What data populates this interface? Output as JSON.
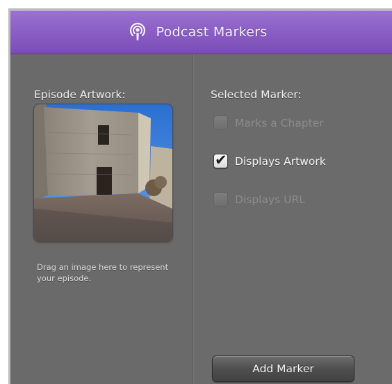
{
  "window": {
    "title": "Podcast Markers",
    "title_icon": "podcast-icon"
  },
  "artwork_pane": {
    "heading": "Episode Artwork:",
    "helper_text": "Drag an image here to represent your episode.",
    "image_description_icon": "artwork-image"
  },
  "marker_pane": {
    "heading": "Selected Marker:",
    "options": [
      {
        "label": "Marks a Chapter",
        "checked": false,
        "enabled": false
      },
      {
        "label": "Displays Artwork",
        "checked": true,
        "enabled": true
      },
      {
        "label": "Displays URL",
        "checked": false,
        "enabled": false
      }
    ],
    "add_button_label": "Add Marker"
  },
  "colors": {
    "titlebar": "#8c60c6",
    "panel": "#6b6b6b",
    "disabled_text": "#8c8c8c"
  }
}
